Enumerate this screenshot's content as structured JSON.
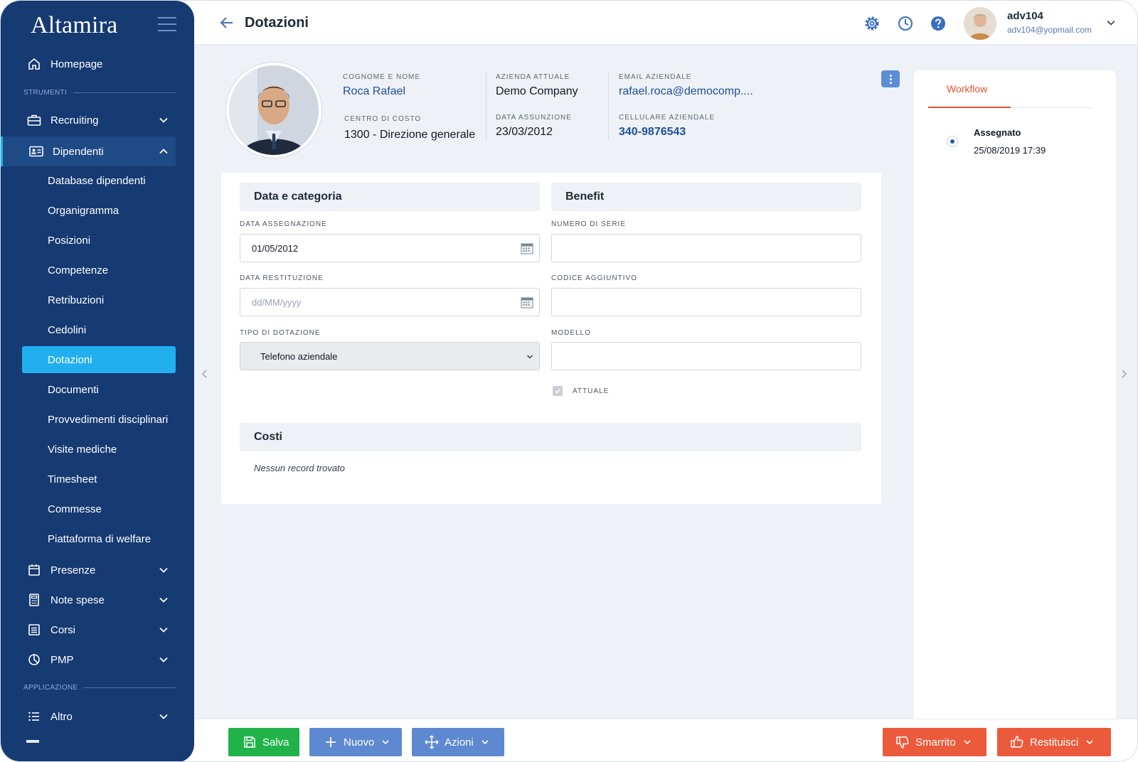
{
  "app": {
    "logo": "Altamira"
  },
  "sidebar": {
    "homepage": "Homepage",
    "section_tools": "STRUMENTI",
    "recruiting": "Recruiting",
    "dipendenti": "Dipendenti",
    "sub_items": [
      "Database dipendenti",
      "Organigramma",
      "Posizioni",
      "Competenze",
      "Retribuzioni",
      "Cedolini",
      "Dotazioni",
      "Documenti",
      "Provvedimenti disciplinari",
      "Visite mediche",
      "Timesheet",
      "Commesse",
      "Piattaforma di welfare"
    ],
    "presenze": "Presenze",
    "note_spese": "Note spese",
    "corsi": "Corsi",
    "pmp": "PMP",
    "section_app": "APPLICAZIONE",
    "altro": "Altro"
  },
  "header": {
    "title": "Dotazioni",
    "user_name": "adv104",
    "user_email": "adv104@yopmail.com"
  },
  "employee": {
    "name_label": "COGNOME E NOME",
    "name": "Roca Rafael",
    "cost_center_label": "CENTRO DI COSTO",
    "cost_center": "1300 - Direzione generale",
    "company_label": "AZIENDA ATTUALE",
    "company": "Demo Company",
    "hire_date_label": "DATA ASSUNZIONE",
    "hire_date": "23/03/2012",
    "email_label": "EMAIL AZIENDALE",
    "email": "rafael.roca@democomp....",
    "phone_label": "CELLULARE AZIENDALE",
    "phone": "340-9876543"
  },
  "form": {
    "section_data": "Data e categoria",
    "section_benefit": "Benefit",
    "assign_date_label": "DATA ASSEGNAZIONE",
    "assign_date_value": "01/05/2012",
    "return_date_label": "DATA RESTITUZIONE",
    "return_date_placeholder": "dd/MM/yyyy",
    "type_label": "TIPO DI DOTAZIONE",
    "type_value": "Telefono aziendale",
    "serial_label": "NUMERO DI SERIE",
    "serial_value": "",
    "extra_code_label": "CODICE AGGIUNTIVO",
    "extra_code_value": "",
    "model_label": "MODELLO",
    "model_value": "",
    "current_label": "ATTUALE",
    "section_costs": "Costi",
    "costs_empty": "Nessun record trovato"
  },
  "workflow": {
    "tab": "Workflow",
    "status": "Assegnato",
    "date": "25/08/2019 17:39"
  },
  "actions": {
    "save": "Salva",
    "new": "Nuovo",
    "actions": "Azioni",
    "lost": "Smarrito",
    "return": "Restituisci"
  },
  "colors": {
    "sidebar": "#163a72",
    "active": "#22aff0",
    "save": "#21b34a",
    "secondary": "#5e89d1",
    "danger": "#ec5a3c",
    "workflow_accent": "#e8532e"
  }
}
